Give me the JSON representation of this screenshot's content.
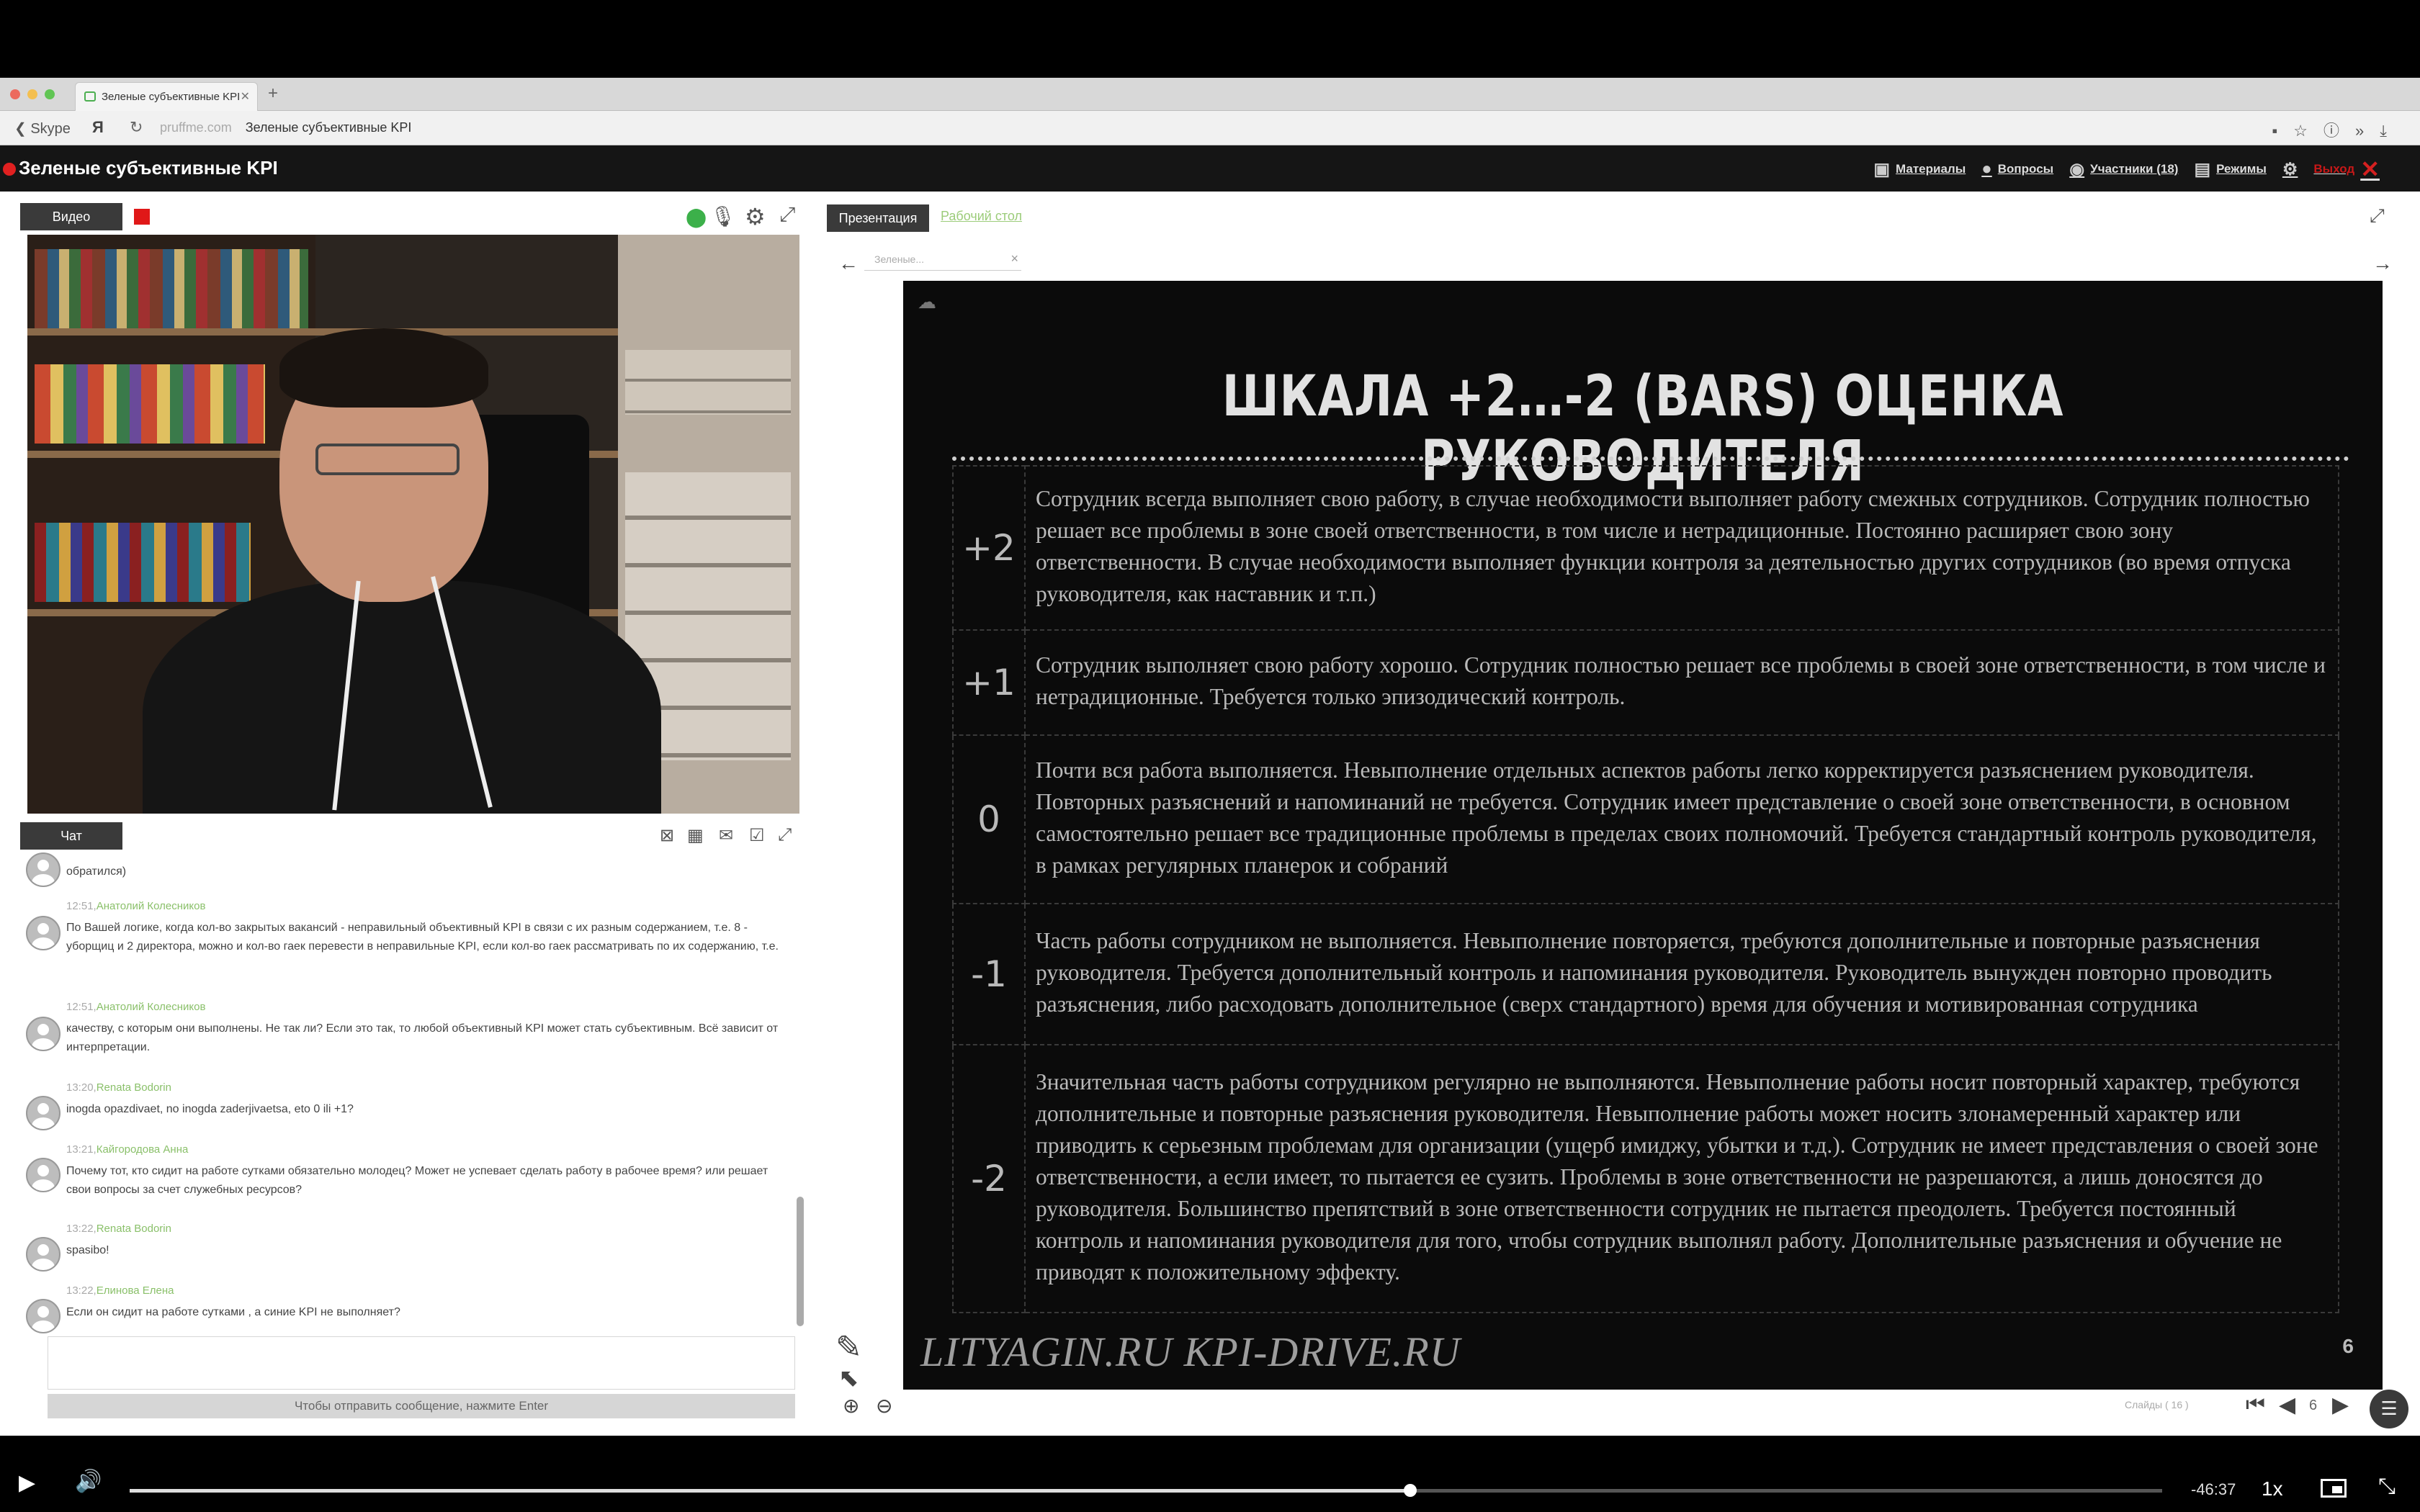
{
  "browser": {
    "tab_title": "Зеленые субъективные KPI",
    "back_label": "Skype",
    "yandex_label": "Я",
    "url_host": "pruffme.com",
    "url_page": "Зеленые субъективные KPI"
  },
  "header": {
    "title": "Зеленые субъективные KPI",
    "menu": {
      "materials": "Материалы",
      "questions": "Вопросы",
      "participants": "Участники (18)",
      "modes": "Режимы",
      "exit": "Выход"
    }
  },
  "video": {
    "tab_label": "Видео"
  },
  "chat": {
    "tab_label": "Чат",
    "send_hint": "Чтобы отправить сообщение, нажмите Enter",
    "messages": [
      {
        "time": "",
        "author": "",
        "text": "обратился)"
      },
      {
        "time": "12:51,",
        "author": "Анатолий Колесников",
        "text": "По Вашей логике, когда кол-во закрытых вакансий - неправильный объективный KPI в связи с их разным содержанием, т.е. 8 - уборщиц и 2 директора, можно и кол-во гаек перевести в неправильные KPI, если кол-во гаек рассматривать по их содержанию, т.е."
      },
      {
        "time": "12:51,",
        "author": "Анатолий Колесников",
        "text": "качеству, с которым они выполнены. Не так ли? Если это так, то любой объективный KPI может стать субъективным. Всё зависит от интерпретации."
      },
      {
        "time": "13:20,",
        "author": "Renata Bodorin",
        "text": "inogda opazdivaet, no inogda zaderjivaetsa, eto 0 ili +1?"
      },
      {
        "time": "13:21,",
        "author": "Кайгородова Анна",
        "text": "Почему тот, кто сидит на работе сутками обязательно молодец? Может не успевает сделать работу в рабочее время? или решает свои вопросы за счет служебных ресурсов?"
      },
      {
        "time": "13:22,",
        "author": "Renata Bodorin",
        "text": "spasibo!"
      },
      {
        "time": "13:22,",
        "author": "Елинова Елена",
        "text": "Если он сидит на работе сутками , а синие KPI не выполняет?"
      }
    ]
  },
  "presentation": {
    "tab_label": "Презентация",
    "desk_label": "Рабочий стол",
    "doc_tab": "Зеленые...",
    "slides_count": "Слайды ( 16 )",
    "page_number": "6"
  },
  "slide": {
    "title": "ШКАЛА +2…-2 (BARS) ОЦЕНКА РУКОВОДИТЕЛЯ",
    "rows": [
      {
        "score": "+2",
        "text": "Сотрудник всегда выполняет свою работу, в случае необходимости выполняет работу смежных сотрудников. Сотрудник полностью решает все проблемы в зоне своей ответственности, в том числе и нетрадиционные. Постоянно расширяет свою зону ответственности. В случае необходимости выполняет функции контроля за деятельностью других сотрудников (во время отпуска руководителя, как наставник и т.п.)"
      },
      {
        "score": "+1",
        "text": "Сотрудник выполняет свою работу хорошо. Сотрудник полностью решает все проблемы в своей зоне ответственности, в том числе и нетрадиционные. Требуется только эпизодический контроль."
      },
      {
        "score": "0",
        "text": "Почти вся работа выполняется. Невыполнение отдельных аспектов работы легко корректируется разъяснением руководителя. Повторных разъяснений и напоминаний не требуется. Сотрудник имеет представление о своей зоне ответственности, в основном самостоятельно решает все традиционные проблемы в пределах своих полномочий. Требуется стандартный контроль руководителя, в рамках регулярных планерок и собраний"
      },
      {
        "score": "-1",
        "text": "Часть работы сотрудником не выполняется. Невыполнение повторяется, требуются дополнительные и повторные разъяснения руководителя. Требуется дополнительный контроль и напоминания руководителя. Руководитель вынужден повторно проводить разъяснения, либо расходовать дополнительное (сверх стандартного) время для обучения и мотивированная сотрудника"
      },
      {
        "score": "-2",
        "text": "Значительная часть работы сотрудником регулярно не выполняются. Невыполнение работы носит повторный характер, требуются дополнительные и повторные разъяснения руководителя. Невыполнение работы может носить злонамеренный характер или приводить к серьезным проблемам для организации (ущерб имиджу, убытки и т.д.). Сотрудник не имеет представления о своей зоне ответственности, а если имеет, то пытается ее сузить. Проблемы в зоне ответственности не разрешаются, а лишь доносятся до руководителя. Большинство препятствий в зоне ответственности сотрудник не пытается преодолеть. Требуется постоянный контроль и напоминания руководителя для того, чтобы сотрудник выполнял работу. Дополнительные разъяснения и обучение не приводят к положительному эффекту."
      }
    ],
    "footer": "LITYAGIN.RU  KPI-DRIVE.RU",
    "page": "6"
  },
  "player": {
    "time_remaining": "-46:37",
    "speed": "1x",
    "progress": 0.63
  },
  "icons": {
    "favicon": "cloud-icon",
    "slide_logo": "cloud-icon"
  },
  "colors": {
    "record_red": "#e02020",
    "desk_link_green": "#9ccc7a",
    "chat_author_green": "#8ac06a",
    "slide_bg": "#0b0b0b"
  }
}
